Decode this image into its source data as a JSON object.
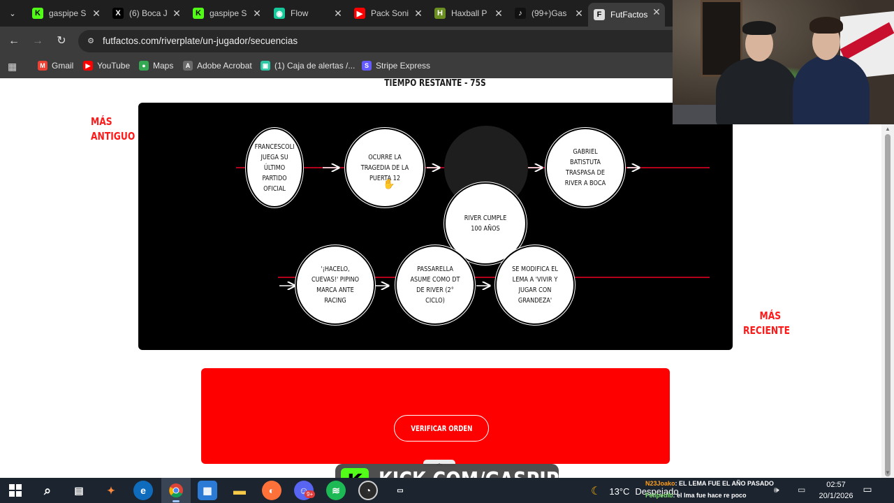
{
  "browser": {
    "tabs": [
      {
        "title": "gaspipe S",
        "favicon": "kick-icon",
        "color": "#53fc18",
        "fav_text": "K"
      },
      {
        "title": "(6) Boca J",
        "favicon": "x-icon",
        "color": "#000000",
        "fav_text": "X"
      },
      {
        "title": "gaspipe S",
        "favicon": "kick-icon",
        "color": "#53fc18",
        "fav_text": "K"
      },
      {
        "title": "Flow",
        "favicon": "flow-icon",
        "color": "#16c79a",
        "fav_text": "◉"
      },
      {
        "title": "Pack Soni",
        "favicon": "youtube-icon",
        "color": "#ff0000",
        "fav_text": "▶"
      },
      {
        "title": "Haxball P",
        "favicon": "haxball-icon",
        "color": "#6b8e23",
        "fav_text": "H"
      },
      {
        "title": "(99+)Gas",
        "favicon": "tiktok-icon",
        "color": "#111111",
        "fav_text": "♪"
      },
      {
        "title": "FutFactos",
        "favicon": "futfactos-icon",
        "color": "#dddddd",
        "fav_text": "F",
        "active": true
      }
    ],
    "tab_close_glyph": "✕",
    "url": "futfactos.com/riverplate/un-jugador/secuencias",
    "bookmarks": [
      {
        "label": "Gmail",
        "icon": "gmail-icon",
        "color": "#ea4335",
        "glyph": "M"
      },
      {
        "label": "YouTube",
        "icon": "youtube-icon",
        "color": "#ff0000",
        "glyph": "▶"
      },
      {
        "label": "Maps",
        "icon": "maps-icon",
        "color": "#34a853",
        "glyph": "●"
      },
      {
        "label": "Adobe Acrobat",
        "icon": "acrobat-icon",
        "color": "#6b6b6b",
        "glyph": "A"
      },
      {
        "label": "(1) Caja de alertas /...",
        "icon": "alerts-icon",
        "color": "#2fc6a5",
        "glyph": "▣"
      },
      {
        "label": "Stripe Express",
        "icon": "stripe-icon",
        "color": "#635bff",
        "glyph": "S"
      }
    ]
  },
  "game": {
    "timer": "TIEMPO RESTANTE - 75S",
    "oldest_label": "MÁS ANTIGUO",
    "newest_label": "MÁS RECIENTE",
    "events": [
      {
        "id": "francescoli",
        "text": "FRANCESCOLI JUEGA SU ÚLTIMO PARTIDO OFICIAL"
      },
      {
        "id": "puerta12",
        "text": "OCURRE LA TRAGEDIA DE LA PUERTA 12"
      },
      {
        "id": "batistuta",
        "text": "GABRIEL BATISTUTA TRASPASA DE RIVER A BOCA"
      },
      {
        "id": "cien-anos",
        "text": "RIVER CUMPLE 100 AÑOS"
      },
      {
        "id": "pipino",
        "text": "'¡HACELO, CUEVAS!' PIPINO MARCA ANTE RACING"
      },
      {
        "id": "passarella",
        "text": "PASSARELLA ASUME COMO DT DE RIVER (2° CICLO)"
      },
      {
        "id": "lema",
        "text": "SE MODIFICA EL LEMA A 'VIVIR Y JUGAR CON GRANDEZA'"
      }
    ],
    "verify_button": "VERIFICAR ORDEN",
    "colors": {
      "accent": "#ff0000",
      "board": "#000000",
      "line": "#b3001b"
    }
  },
  "overlay": {
    "kick_text": "KICK.COM/GASPIPE",
    "kick_logo": "K",
    "kick_color": "#53fc18",
    "collapse_glyph": "︿"
  },
  "taskbar": {
    "apps": [
      "windows-start-icon",
      "search-icon",
      "task-view-icon",
      "copilot-icon",
      "edge-icon",
      "chrome-icon",
      "store-icon",
      "files-icon",
      "firefox-icon",
      "discord-icon",
      "spotify-icon",
      "obs-icon",
      "game-icon"
    ],
    "discord_badge": "9+",
    "weather_temp": "13°C",
    "weather_desc": "Despejado",
    "chat": [
      {
        "user": "N23Joako",
        "message": ": EL LEMA FUE EL AÑO PASADO",
        "color": "#ff9f1a"
      },
      {
        "user": "Felipedib",
        "message": ": el lma fue hace re poco",
        "color": "#7ee26f"
      }
    ],
    "time": "02:57",
    "date": "20/1/2026"
  }
}
